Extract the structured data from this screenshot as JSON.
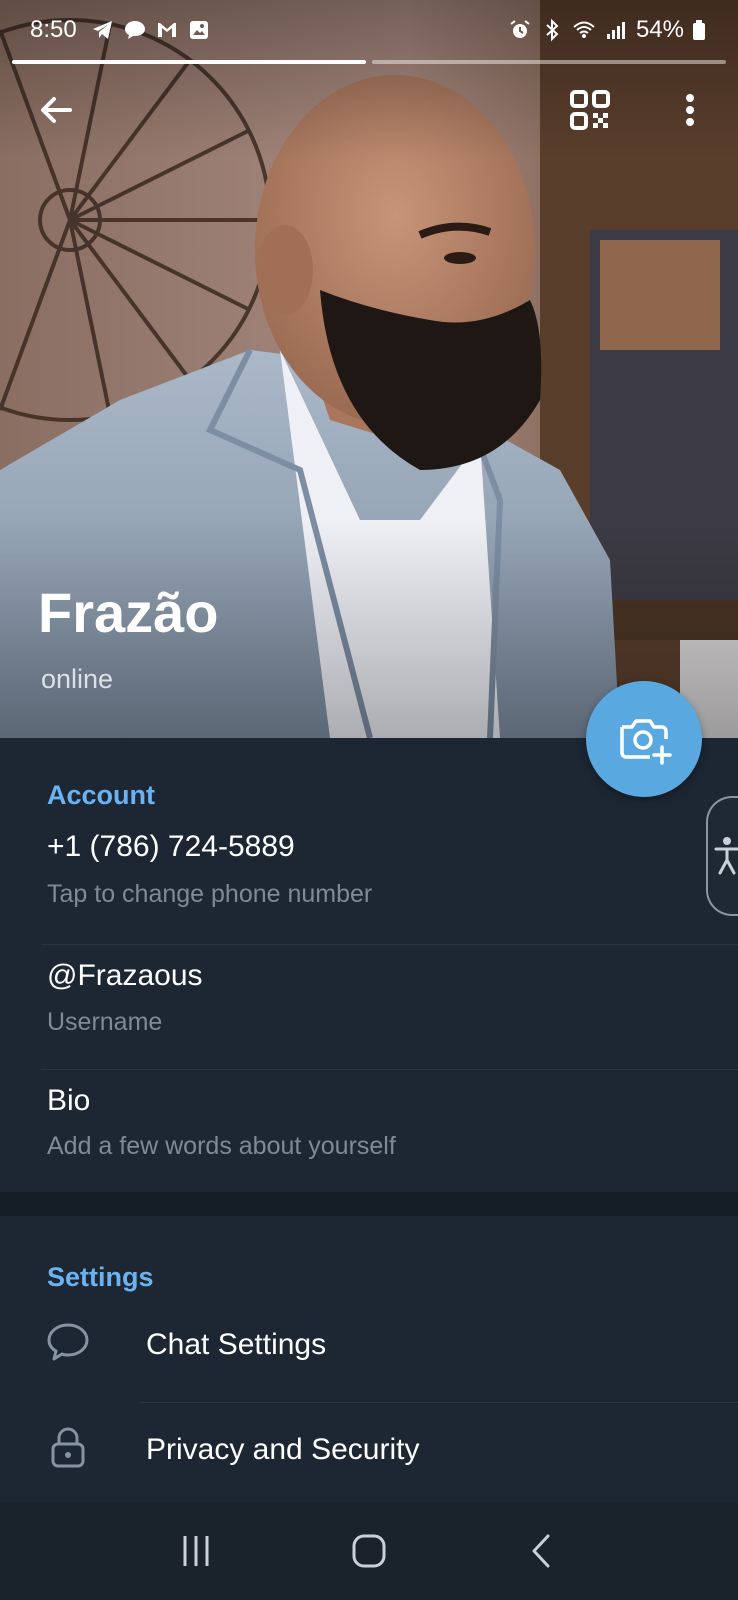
{
  "status_bar": {
    "time": "8:50",
    "battery": "54%",
    "left_icons": [
      "telegram-icon",
      "chat-bubble-icon",
      "gmail-icon",
      "gallery-icon"
    ],
    "right_icons": [
      "alarm-icon",
      "bluetooth-icon",
      "wifi-icon",
      "signal-icon",
      "battery-icon"
    ]
  },
  "header": {
    "name": "Frazão",
    "status": "online",
    "actions": [
      "back-icon",
      "qr-code-icon",
      "more-vert-icon"
    ]
  },
  "account": {
    "title": "Account",
    "phone": "+1 (786) 724-5889",
    "phone_hint": "Tap to change phone number",
    "username": "@Frazaous",
    "username_hint": "Username",
    "bio": "Bio",
    "bio_hint": "Add a few words about yourself"
  },
  "settings": {
    "title": "Settings",
    "items": [
      {
        "label": "Chat Settings",
        "icon": "chat-bubble-icon"
      },
      {
        "label": "Privacy and Security",
        "icon": "lock-icon"
      }
    ]
  },
  "colors": {
    "background": "#1d2733",
    "accent": "#6ab3f3",
    "fab": "#5aa8e0",
    "secondary_text": "#7e8a97"
  }
}
